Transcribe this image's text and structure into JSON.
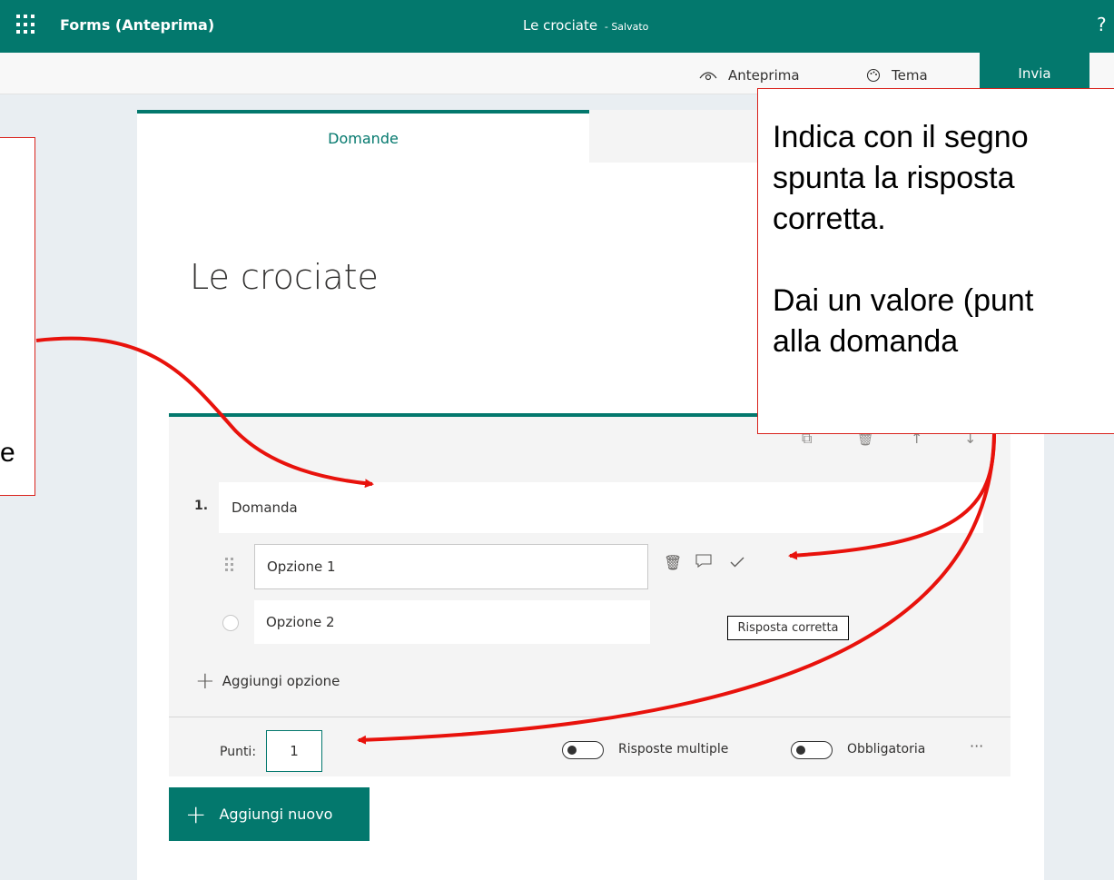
{
  "topbar": {
    "app_name": "Forms (Anteprima)",
    "doc_title": "Le crociate",
    "doc_status": "- Salvato",
    "help": "?"
  },
  "commands": {
    "preview": "Anteprima",
    "theme": "Tema",
    "send": "Invia"
  },
  "tabs": {
    "questions": "Domande"
  },
  "form": {
    "title": "Le crociate"
  },
  "question": {
    "number": "1.",
    "text": "Domanda",
    "options": [
      "Opzione 1",
      "Opzione 2"
    ],
    "add_option": "Aggiungi opzione",
    "points_label": "Punti:",
    "points_value": "1",
    "multiple_answers": "Risposte multiple",
    "required": "Obbligatoria",
    "more": "···"
  },
  "add_new": "Aggiungi nuovo",
  "tooltip": "Risposta corretta",
  "callouts": {
    "left_text": "e",
    "right_lines": [
      "Indica con il segno",
      "spunta la risposta",
      "corretta.",
      "",
      "Dai un valore (punt",
      "alla domanda"
    ]
  },
  "colors": {
    "accent": "#03786d",
    "annotation": "#e8120c"
  }
}
